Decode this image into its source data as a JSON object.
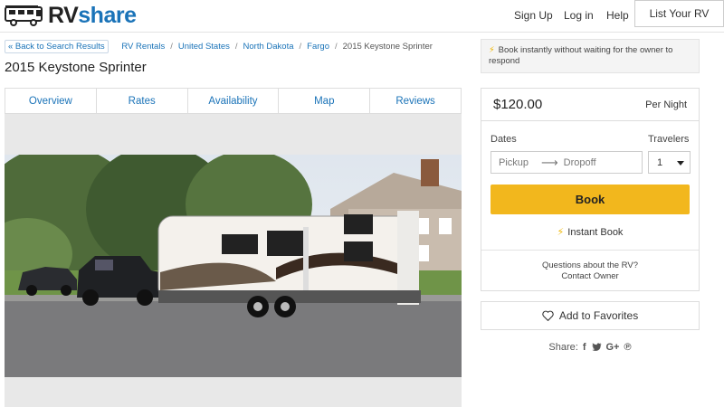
{
  "header": {
    "logo_rv": "RV",
    "logo_share": "share",
    "nav": {
      "signup": "Sign Up",
      "login": "Log in",
      "help": "Help",
      "list_rv": "List Your RV"
    }
  },
  "breadcrumb": {
    "back": "« Back to Search Results",
    "items": [
      "RV Rentals",
      "United States",
      "North Dakota",
      "Fargo"
    ],
    "current": "2015 Keystone Sprinter"
  },
  "listing": {
    "title": "2015 Keystone Sprinter",
    "tabs": [
      "Overview",
      "Rates",
      "Availability",
      "Map",
      "Reviews"
    ]
  },
  "booking": {
    "instant_notice": "Book instantly without waiting for the owner to respond",
    "price": "$120.00",
    "per_night": "Per Night",
    "dates_label": "Dates",
    "travelers_label": "Travelers",
    "pickup_placeholder": "Pickup",
    "dropoff_placeholder": "Dropoff",
    "travelers_value": "1",
    "book_label": "Book",
    "instant_book": "Instant Book",
    "questions": "Questions about the RV?",
    "contact_owner": "Contact Owner"
  },
  "favorites_label": "Add to Favorites",
  "share": {
    "label": "Share:",
    "icons": [
      "facebook-icon",
      "twitter-icon",
      "google-plus-icon",
      "pinterest-icon"
    ]
  },
  "colors": {
    "brand_blue": "#1a73b8",
    "book_yellow": "#f2b71d",
    "bolt_yellow": "#f0b90b"
  }
}
